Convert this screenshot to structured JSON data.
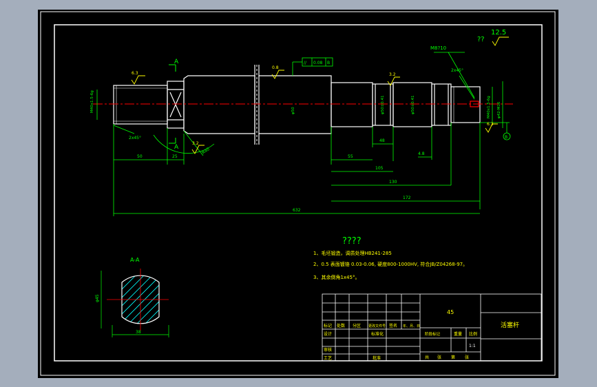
{
  "colors": {
    "background": "#a4aebc",
    "paper": "#000000",
    "frame": "#ffffff",
    "outline": "#ffffff",
    "dimension": "#00ff00",
    "centerline": "#ff0000",
    "annotation": "#ffff00",
    "hatch": "#00ffff"
  },
  "drawing": {
    "roughness_general": "12.5",
    "roughness_general_prefix": "??",
    "thread_label": "M8?10",
    "section_marker": "A",
    "section_title": "A-A",
    "geometric_tolerance": [
      "//",
      "0.08",
      "B"
    ],
    "datum_label": "B",
    "labels": {
      "left_thread": "M40x1.5-6g",
      "chamfer_left": "2x45°",
      "chamfer_right": "2x45°",
      "diameter_main": "φ50",
      "diameter_mid": "φ50±0.41",
      "diameter_right_step": "φ50±0.41",
      "right_thread": "M40x1.5-6g",
      "right_end": "φ42-M16",
      "roughness_1": "6.3",
      "roughness_2": "0.8",
      "roughness_3": "3.2",
      "roughness_4": "3.2",
      "roughness_5": "6.3",
      "radius_label": "R40",
      "dim_48": "48",
      "dim_46": "4.8",
      "dim_40": "4.8",
      "section_dia": "φ45",
      "section_width": "38"
    },
    "dimensions": {
      "d_50": "50",
      "d_25": "25",
      "d_55": "55",
      "d_105": "105",
      "d_130": "130",
      "d_172": "172",
      "d_total": "632"
    }
  },
  "notes": {
    "heading": "????",
    "lines": [
      "1、毛坯锻造，调质处理HB241-285",
      "2、0.5  表面镀铬 0.03-0.06, 硬度800-1000HV, 符合JB/Z04268-97。",
      "3、其余倒角1x45°。"
    ]
  },
  "title_block": {
    "material": "45",
    "part_name": "活塞杆",
    "header_row": [
      "标记",
      "处数",
      "分区",
      "更改文件号",
      "签名",
      "年、月、日"
    ],
    "row_design": [
      "设计",
      "",
      "",
      "标准化",
      "",
      ""
    ],
    "row_check": [
      "审核",
      "",
      "",
      "",
      "",
      ""
    ],
    "row_craft": [
      "工艺",
      "",
      "",
      "批准",
      "",
      ""
    ],
    "stage_row": [
      "阶段标记",
      "重量",
      "比例"
    ],
    "scale": "1:1",
    "sheet_row": [
      "共",
      "张",
      "第",
      "张"
    ]
  }
}
